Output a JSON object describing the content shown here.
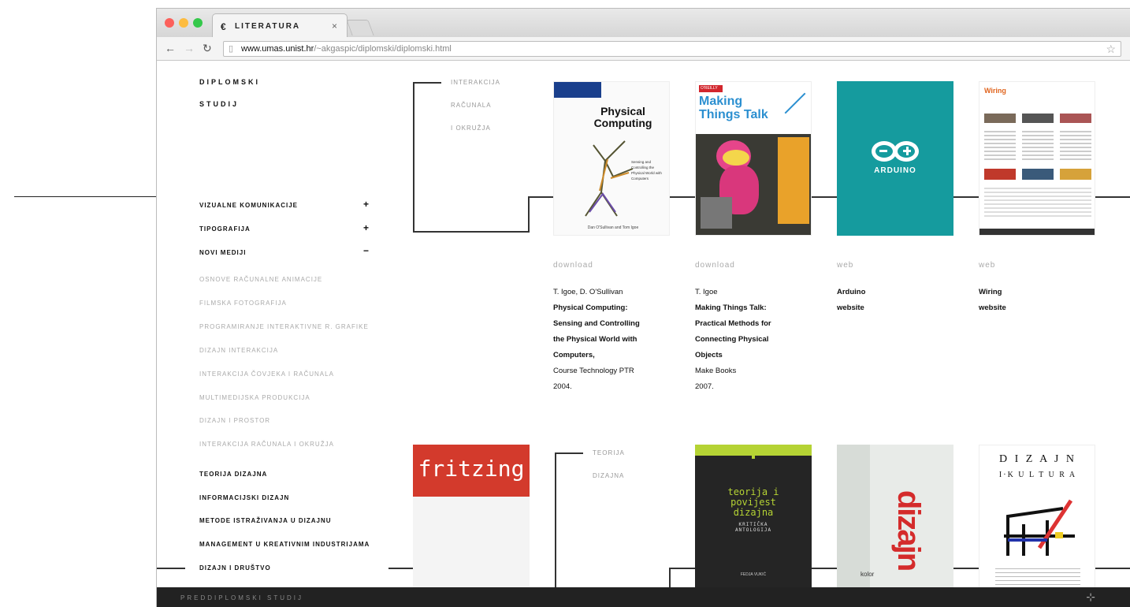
{
  "browser": {
    "tab_title": "LITERATURA",
    "tab_favicon": "€",
    "tab_close": "×",
    "url_host": "www.umas.unist.hr",
    "url_path": "/~akgaspic/diplomski/diplomski.html",
    "traffic_lights": [
      "#fc605b",
      "#fdbc40",
      "#34c84a"
    ]
  },
  "sidebar": {
    "header_line1": "DIPLOMSKI",
    "header_line2": "STUDIJ",
    "groups": [
      {
        "label": "VIZUALNE KOMUNIKACIJE",
        "toggle": "+"
      },
      {
        "label": "TIPOGRAFIJA",
        "toggle": "+"
      },
      {
        "label": "NOVI MEDIJI",
        "toggle": "−"
      }
    ],
    "sub_items": [
      "OSNOVE RAČUNALNE ANIMACIJE",
      "FILMSKA FOTOGRAFIJA",
      "PROGRAMIRANJE INTERAKTIVNE R. GRAFIKE",
      "DIZAJN INTERAKCIJA",
      "INTERAKCIJA ČOVJEKA I RAČUNALA",
      "MULTIMEDIJSKA PRODUKCIJA",
      "DIZAJN I PROSTOR",
      "INTERAKCIJA RAČUNALA I OKRUŽJA"
    ],
    "bottom_items": [
      "TEORIJA DIZAJNA",
      "INFORMACIJSKI DIZAJN",
      "METODE ISTRAŽIVANJA U DIZAJNU",
      "MANAGEMENT U KREATIVNIM INDUSTRIJAMA",
      "DIZAJN I DRUŠTVO"
    ]
  },
  "section1": {
    "label_lines": [
      "INTERAKCIJA",
      "RAČUNALA",
      "I OKRUŽJA"
    ]
  },
  "section2": {
    "label_lines": [
      "TEORIJA",
      "DIZAJNA"
    ]
  },
  "items": [
    {
      "tag": "download",
      "author": "T. Igoe, D. O'Sullivan",
      "title_lines": [
        "Physical Computing:",
        "Sensing and Controlling",
        "the Physical World with",
        "Computers,"
      ],
      "publisher": "Course Technology PTR",
      "year": "2004.",
      "cover_title": "Physical Computing",
      "cover_sub": "Sensing and Controlling the Physical World with Computers",
      "cover_authors": "Dan O'Sullivan and Tom Igoe"
    },
    {
      "tag": "download",
      "author": "T. Igoe",
      "title_lines": [
        "Making Things Talk:",
        "Practical Methods for",
        "Connecting Physical",
        "Objects"
      ],
      "publisher": "Make Books",
      "year": "2007.",
      "cover_title": "Making Things Talk",
      "cover_badge": "O'REILLY"
    },
    {
      "tag": "web",
      "author": "Arduino",
      "title_lines": [
        "website"
      ],
      "cover_logo": "ARDUINO"
    },
    {
      "tag": "web",
      "author": "Wiring",
      "title_lines": [
        "website"
      ],
      "cover_title": "Wiring"
    }
  ],
  "row2_covers": {
    "fritzing": "fritzing",
    "teorija_lines": [
      "teorija i",
      "povijest",
      "dizajna"
    ],
    "teorija_sub": "KRITIČKA ANTOLOGIJA",
    "teorija_editor": "FEDJA VUKIĆ",
    "dizajn_vertical": "dizajn",
    "dizajn_small": "kolor",
    "kultura_top": "D I Z A J N",
    "kultura_bottom": "I·K U L T U R A"
  },
  "footer": {
    "label": "PREDDIPLOMSKI STUDIJ",
    "icon": "⊹"
  }
}
